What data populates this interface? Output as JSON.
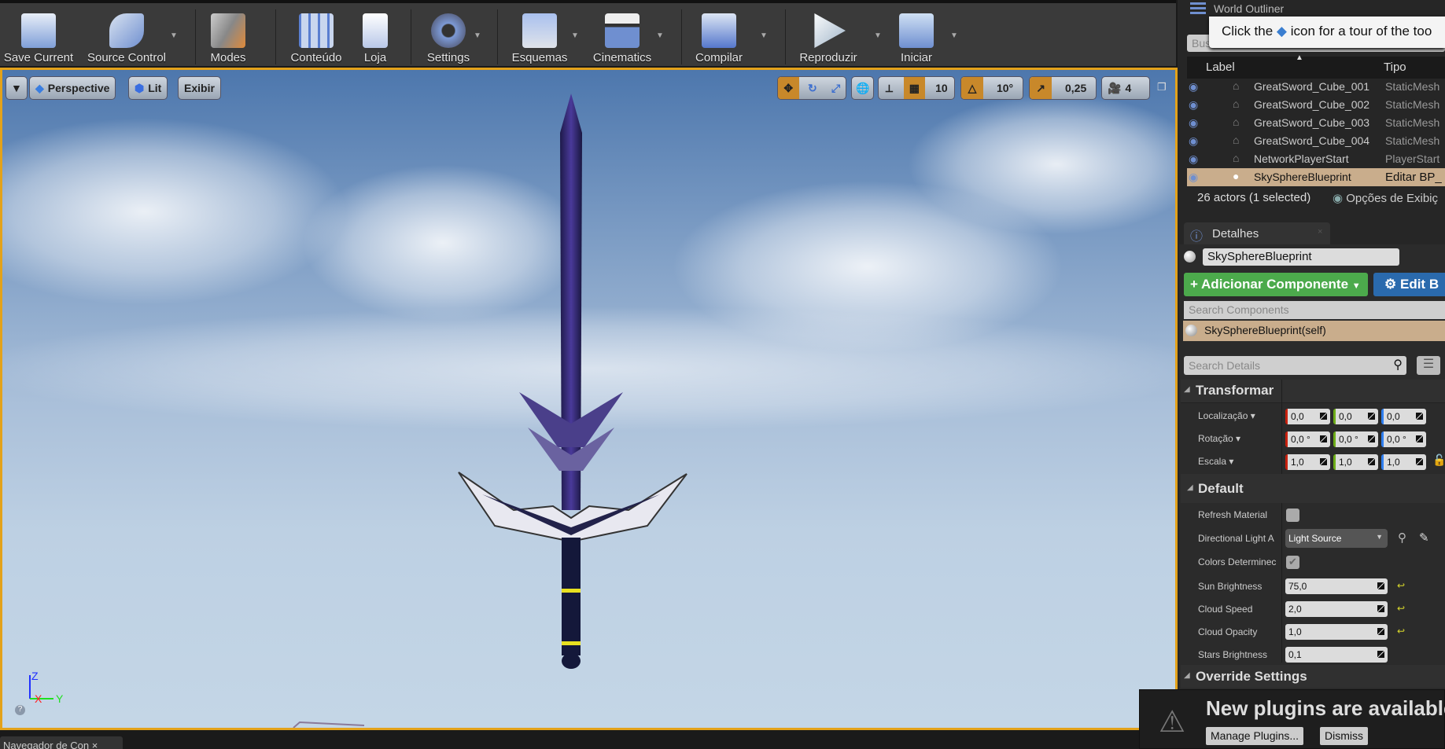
{
  "toolbar": {
    "items": [
      {
        "label": "Save Current",
        "icon": "save-icon"
      },
      {
        "label": "Source Control",
        "icon": "source-control-icon"
      },
      {
        "label": "Modes",
        "icon": "modes-icon"
      },
      {
        "label": "Conteúdo",
        "icon": "content-icon"
      },
      {
        "label": "Loja",
        "icon": "marketplace-icon"
      },
      {
        "label": "Settings",
        "icon": "settings-icon"
      },
      {
        "label": "Esquemas",
        "icon": "blueprints-icon"
      },
      {
        "label": "Cinematics",
        "icon": "cinematics-icon"
      },
      {
        "label": "Compilar",
        "icon": "build-icon"
      },
      {
        "label": "Reproduzir",
        "icon": "play-icon"
      },
      {
        "label": "Iniciar",
        "icon": "launch-icon"
      }
    ]
  },
  "viewport": {
    "perspective": "Perspective",
    "lit": "Lit",
    "show": "Exibir",
    "grid_snap": "10",
    "rot_snap": "10°",
    "scale_snap": "0,25",
    "cam_speed": "4",
    "axis": {
      "z": "Z",
      "x": "X",
      "y": "Y"
    }
  },
  "outliner": {
    "tab": "World Outliner",
    "tooltip_pre": "Click the",
    "tooltip_post": "icon for a tour of the too",
    "search_placeholder": "Buscar...",
    "col_label": "Label",
    "col_type": "Tipo",
    "rows": [
      {
        "label": "GreatSword_Cube_001",
        "type": "StaticMesh"
      },
      {
        "label": "GreatSword_Cube_002",
        "type": "StaticMesh"
      },
      {
        "label": "GreatSword_Cube_003",
        "type": "StaticMesh"
      },
      {
        "label": "GreatSword_Cube_004",
        "type": "StaticMesh"
      },
      {
        "label": "NetworkPlayerStart",
        "type": "PlayerStart"
      },
      {
        "label": "SkySphereBlueprint",
        "type": "Editar BP_"
      }
    ],
    "status": "26 actors (1 selected)",
    "view_options": "Opções de Exibiç"
  },
  "details": {
    "tab": "Detalhes",
    "name": "SkySphereBlueprint",
    "add_component": "Adicionar Componente",
    "edit_bp": "Edit B",
    "search_components": "Search Components",
    "self": "SkySphereBlueprint(self)",
    "search_details": "Search Details",
    "transform": {
      "title": "Transformar",
      "location": {
        "label": "Localização",
        "x": "0,0",
        "y": "0,0",
        "z": "0,0"
      },
      "rotation": {
        "label": "Rotação",
        "x": "0,0 °",
        "y": "0,0 °",
        "z": "0,0 °"
      },
      "scale": {
        "label": "Escala",
        "x": "1,0",
        "y": "1,0",
        "z": "1,0"
      }
    },
    "default": {
      "title": "Default",
      "refresh_material": "Refresh Material",
      "directional_light": "Directional Light A",
      "directional_light_value": "Light Source",
      "colors_determined": "Colors Determinec",
      "sun_brightness": "Sun Brightness",
      "sun_brightness_value": "75,0",
      "cloud_speed": "Cloud Speed",
      "cloud_speed_value": "2,0",
      "cloud_opacity": "Cloud Opacity",
      "cloud_opacity_value": "1,0",
      "stars_brightness": "Stars Brightness",
      "stars_brightness_value": "0,1"
    },
    "override": "Override Settings"
  },
  "notification": {
    "title": "New plugins are available",
    "manage": "Manage Plugins...",
    "dismiss": "Dismiss"
  },
  "bottom_tab": "Navegador de Con"
}
